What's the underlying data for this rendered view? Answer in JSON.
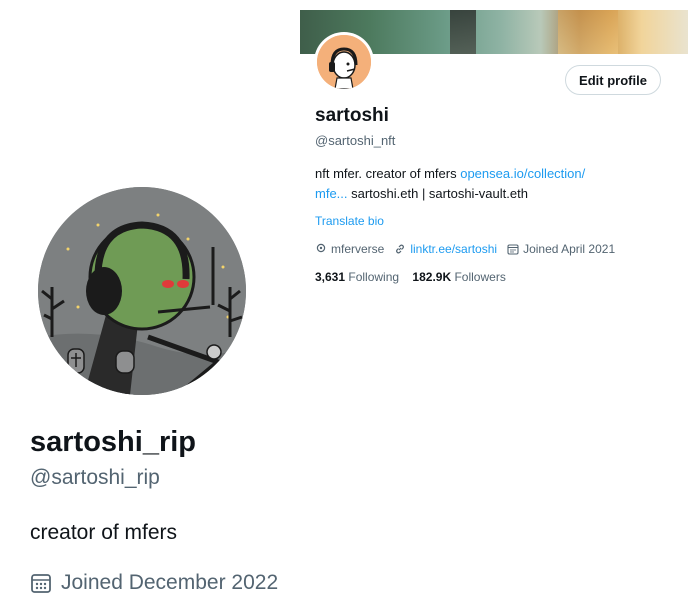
{
  "back_profile": {
    "name": "sartoshi",
    "handle": "@sartoshi_nft",
    "edit_button": "Edit profile",
    "bio_text_1": "nft mfer. creator of mfers ",
    "bio_link_1": "opensea.io/collection/",
    "bio_link_2": "mfe...",
    "bio_text_2": " sartoshi.eth | sartoshi-vault.eth",
    "translate": "Translate bio",
    "location": "mferverse",
    "website": "linktr.ee/sartoshi",
    "joined": "Joined April 2021",
    "following_count": "3,631",
    "following_label": "Following",
    "followers_count": "182.9K",
    "followers_label": "Followers",
    "icons": [
      "location-pin-icon",
      "link-icon",
      "calendar-icon"
    ],
    "colors": {
      "link": "#1d9bf0",
      "secondary_text": "#536471"
    }
  },
  "front_profile": {
    "name": "sartoshi_rip",
    "handle": "@sartoshi_rip",
    "bio": "creator of mfers",
    "joined": "Joined December 2022",
    "icons": [
      "calendar-icon"
    ]
  }
}
